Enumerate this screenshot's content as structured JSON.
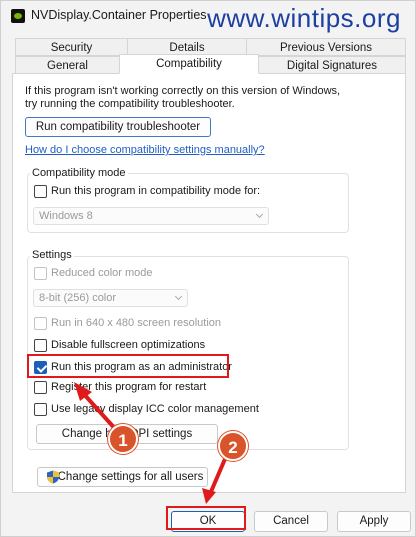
{
  "window": {
    "title": "NVDisplay.Container Properties"
  },
  "watermark": "www.wintips.org",
  "tabs": {
    "row1": [
      "Security",
      "Details",
      "Previous Versions"
    ],
    "row2": [
      "General",
      "Compatibility",
      "Digital Signatures"
    ],
    "active": "Compatibility"
  },
  "intro_text": "If this program isn't working correctly on this version of Windows, try running the compatibility troubleshooter.",
  "run_troubleshooter_label": "Run compatibility troubleshooter",
  "manual_link": "How do I choose compatibility settings manually?",
  "compat_mode": {
    "title": "Compatibility mode",
    "checkbox_label": "Run this program in compatibility mode for:",
    "checked": false,
    "select_value": "Windows 8"
  },
  "settings": {
    "title": "Settings",
    "reduced_color": {
      "label": "Reduced color mode",
      "checked": false,
      "disabled": true
    },
    "color_select": "8-bit (256) color",
    "resolution": {
      "label": "Run in 640 x 480 screen resolution",
      "checked": false,
      "disabled": true
    },
    "fullscreen": {
      "label": "Disable fullscreen optimizations",
      "checked": false
    },
    "admin": {
      "label": "Run this program as an administrator",
      "checked": true
    },
    "restart": {
      "label": "Register this program for restart",
      "checked": false
    },
    "icc": {
      "label": "Use legacy display ICC color management",
      "checked": false
    },
    "dpi_button": "Change high DPI settings"
  },
  "all_users_button": "Change settings for all users",
  "buttons": {
    "ok": "OK",
    "cancel": "Cancel",
    "apply": "Apply"
  },
  "annotations": {
    "step1": "1",
    "step2": "2",
    "highlight_color": "#e01a1a",
    "badge_color": "#d9542b"
  },
  "icons": {
    "app": "nvidia-icon",
    "shield": "uac-shield-icon"
  }
}
